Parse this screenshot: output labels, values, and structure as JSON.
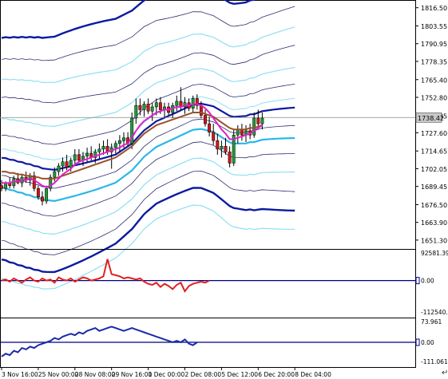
{
  "colors": {
    "background": "#ffffff",
    "frame": "#000000",
    "candle_up": "#1f9a3a",
    "candle_down": "#d01818",
    "ma_fast": "#e020c8",
    "ma_slow": "#9a5028",
    "band_thick": "#0b1aa0",
    "band_thin": "#2c2c70",
    "band_cyan": "#29b7e6",
    "band_cyan_light": "#8fdff3",
    "osc1": "#e02020",
    "osc2": "#1a2aa8",
    "level_line": "#000080",
    "price_marker_bg": "#c8c8c8"
  },
  "chart_data": [
    {
      "type": "candlestick",
      "symbol": "price",
      "ylim": [
        1645,
        1822
      ],
      "y_ticks": [
        "1816.50",
        "1803.55",
        "1790.95",
        "1778.35",
        "1765.40",
        "1752.80",
        "1739.85",
        "1727.60",
        "1714.65",
        "1702.05",
        "1689.45",
        "1676.50",
        "1663.90",
        "1651.30"
      ],
      "current_price_label": "1738.42",
      "current_price": 1738.42,
      "x_labels": [
        "3 Nov 16:00",
        "25 Nov 00:00",
        "28 Nov 08:00",
        "29 Nov 16:00",
        "1 Dec 00:00",
        "2 Dec 08:00",
        "5 Dec 12:00",
        "6 Dec 20:00",
        "8 Dec 04:00"
      ],
      "x_label_index": [
        0,
        9,
        18,
        27,
        36,
        45,
        54,
        63,
        72
      ],
      "candles": [
        {
          "o": 1690,
          "h": 1694,
          "l": 1686,
          "c": 1688
        },
        {
          "o": 1688,
          "h": 1693,
          "l": 1686,
          "c": 1692
        },
        {
          "o": 1692,
          "h": 1696,
          "l": 1688,
          "c": 1690
        },
        {
          "o": 1690,
          "h": 1697,
          "l": 1688,
          "c": 1695
        },
        {
          "o": 1695,
          "h": 1699,
          "l": 1691,
          "c": 1692
        },
        {
          "o": 1692,
          "h": 1698,
          "l": 1689,
          "c": 1696
        },
        {
          "o": 1696,
          "h": 1700,
          "l": 1692,
          "c": 1694
        },
        {
          "o": 1694,
          "h": 1699,
          "l": 1690,
          "c": 1697
        },
        {
          "o": 1697,
          "h": 1700,
          "l": 1686,
          "c": 1688
        },
        {
          "o": 1688,
          "h": 1690,
          "l": 1680,
          "c": 1682
        },
        {
          "o": 1682,
          "h": 1686,
          "l": 1676,
          "c": 1679
        },
        {
          "o": 1679,
          "h": 1690,
          "l": 1677,
          "c": 1688
        },
        {
          "o": 1688,
          "h": 1698,
          "l": 1686,
          "c": 1696
        },
        {
          "o": 1696,
          "h": 1703,
          "l": 1693,
          "c": 1700
        },
        {
          "o": 1700,
          "h": 1706,
          "l": 1697,
          "c": 1704
        },
        {
          "o": 1704,
          "h": 1710,
          "l": 1700,
          "c": 1707
        },
        {
          "o": 1707,
          "h": 1712,
          "l": 1701,
          "c": 1703
        },
        {
          "o": 1703,
          "h": 1710,
          "l": 1700,
          "c": 1708
        },
        {
          "o": 1708,
          "h": 1716,
          "l": 1705,
          "c": 1712
        },
        {
          "o": 1712,
          "h": 1716,
          "l": 1706,
          "c": 1708
        },
        {
          "o": 1708,
          "h": 1714,
          "l": 1704,
          "c": 1711
        },
        {
          "o": 1711,
          "h": 1717,
          "l": 1707,
          "c": 1713
        },
        {
          "o": 1713,
          "h": 1718,
          "l": 1708,
          "c": 1710
        },
        {
          "o": 1710,
          "h": 1716,
          "l": 1706,
          "c": 1714
        },
        {
          "o": 1714,
          "h": 1720,
          "l": 1709,
          "c": 1716
        },
        {
          "o": 1716,
          "h": 1722,
          "l": 1712,
          "c": 1718
        },
        {
          "o": 1718,
          "h": 1723,
          "l": 1712,
          "c": 1714
        },
        {
          "o": 1714,
          "h": 1720,
          "l": 1702,
          "c": 1717
        },
        {
          "o": 1717,
          "h": 1722,
          "l": 1713,
          "c": 1720
        },
        {
          "o": 1720,
          "h": 1726,
          "l": 1714,
          "c": 1722
        },
        {
          "o": 1722,
          "h": 1728,
          "l": 1717,
          "c": 1724
        },
        {
          "o": 1724,
          "h": 1728,
          "l": 1718,
          "c": 1720
        },
        {
          "o": 1720,
          "h": 1742,
          "l": 1716,
          "c": 1738
        },
        {
          "o": 1738,
          "h": 1752,
          "l": 1734,
          "c": 1747
        },
        {
          "o": 1747,
          "h": 1752,
          "l": 1740,
          "c": 1744
        },
        {
          "o": 1744,
          "h": 1750,
          "l": 1739,
          "c": 1748
        },
        {
          "o": 1748,
          "h": 1752,
          "l": 1741,
          "c": 1743
        },
        {
          "o": 1743,
          "h": 1749,
          "l": 1736,
          "c": 1746
        },
        {
          "o": 1746,
          "h": 1752,
          "l": 1740,
          "c": 1749
        },
        {
          "o": 1749,
          "h": 1753,
          "l": 1741,
          "c": 1744
        },
        {
          "o": 1744,
          "h": 1749,
          "l": 1738,
          "c": 1746
        },
        {
          "o": 1746,
          "h": 1749,
          "l": 1740,
          "c": 1742
        },
        {
          "o": 1742,
          "h": 1749,
          "l": 1738,
          "c": 1747
        },
        {
          "o": 1747,
          "h": 1754,
          "l": 1743,
          "c": 1750
        },
        {
          "o": 1750,
          "h": 1760,
          "l": 1744,
          "c": 1746
        },
        {
          "o": 1746,
          "h": 1753,
          "l": 1741,
          "c": 1749
        },
        {
          "o": 1749,
          "h": 1752,
          "l": 1743,
          "c": 1745
        },
        {
          "o": 1745,
          "h": 1754,
          "l": 1742,
          "c": 1752
        },
        {
          "o": 1752,
          "h": 1755,
          "l": 1744,
          "c": 1747
        },
        {
          "o": 1747,
          "h": 1750,
          "l": 1738,
          "c": 1740
        },
        {
          "o": 1740,
          "h": 1744,
          "l": 1732,
          "c": 1734
        },
        {
          "o": 1734,
          "h": 1739,
          "l": 1725,
          "c": 1728
        },
        {
          "o": 1728,
          "h": 1734,
          "l": 1719,
          "c": 1722
        },
        {
          "o": 1722,
          "h": 1727,
          "l": 1712,
          "c": 1716
        },
        {
          "o": 1716,
          "h": 1722,
          "l": 1710,
          "c": 1718
        },
        {
          "o": 1718,
          "h": 1724,
          "l": 1712,
          "c": 1714
        },
        {
          "o": 1714,
          "h": 1718,
          "l": 1703,
          "c": 1706
        },
        {
          "o": 1706,
          "h": 1730,
          "l": 1704,
          "c": 1726
        },
        {
          "o": 1726,
          "h": 1733,
          "l": 1720,
          "c": 1730
        },
        {
          "o": 1730,
          "h": 1734,
          "l": 1722,
          "c": 1726
        },
        {
          "o": 1726,
          "h": 1733,
          "l": 1721,
          "c": 1729
        },
        {
          "o": 1729,
          "h": 1734,
          "l": 1723,
          "c": 1726
        },
        {
          "o": 1726,
          "h": 1742,
          "l": 1724,
          "c": 1738
        },
        {
          "o": 1738,
          "h": 1744,
          "l": 1731,
          "c": 1734
        },
        {
          "o": 1734,
          "h": 1742,
          "l": 1730,
          "c": 1738
        }
      ],
      "ma_fast": [
        1692,
        1692,
        1692,
        1693,
        1693,
        1694,
        1694,
        1695,
        1694,
        1692,
        1690,
        1689,
        1690,
        1692,
        1695,
        1698,
        1700,
        1702,
        1705,
        1707,
        1708,
        1709,
        1710,
        1711,
        1712,
        1713,
        1714,
        1715,
        1716,
        1717,
        1719,
        1720,
        1724,
        1729,
        1733,
        1736,
        1738,
        1740,
        1742,
        1743,
        1744,
        1744,
        1745,
        1746,
        1746,
        1747,
        1747,
        1748,
        1748,
        1747,
        1745,
        1742,
        1738,
        1734,
        1730,
        1727,
        1723,
        1723,
        1724,
        1725,
        1726,
        1727,
        1729,
        1731,
        1733
      ],
      "ma_slow": [
        1700,
        1700,
        1699,
        1699,
        1698,
        1698,
        1697,
        1697,
        1696,
        1696,
        1695,
        1695,
        1695,
        1695,
        1696,
        1697,
        1698,
        1699,
        1700,
        1701,
        1702,
        1703,
        1704,
        1705,
        1706,
        1707,
        1708,
        1709,
        1710,
        1712,
        1714,
        1716,
        1718,
        1721,
        1724,
        1727,
        1729,
        1731,
        1733,
        1734,
        1735,
        1736,
        1737,
        1738,
        1739,
        1740,
        1741,
        1742,
        1742,
        1742,
        1741,
        1740,
        1739,
        1737,
        1735,
        1733,
        1731,
        1730,
        1730,
        1730,
        1730,
        1731,
        1731,
        1732,
        1733
      ]
    },
    {
      "type": "line",
      "series": [
        {
          "values": [
            0,
            1,
            -1,
            2,
            0,
            -2,
            1,
            3,
            0,
            -1,
            2,
            0,
            1,
            -2,
            3,
            1,
            0,
            2,
            -1,
            1,
            3,
            2,
            0,
            1,
            2,
            4,
            20,
            6,
            5,
            4,
            2,
            3,
            2,
            1,
            2,
            -1,
            -3,
            -4,
            -2,
            -6,
            -3,
            -5,
            -8,
            -4,
            -2,
            -10,
            -5,
            -3,
            -2,
            -1,
            -2,
            0
          ]
        }
      ],
      "y_ticks": [
        "92581.39",
        "0.00",
        "-112540.71"
      ],
      "ylim": [
        -30,
        25
      ],
      "zero_level": 0
    },
    {
      "type": "line",
      "series": [
        {
          "values": [
            -10,
            -8,
            -9,
            -6,
            -7,
            -4,
            -5,
            -3,
            -4,
            -2,
            -1,
            0,
            1,
            3,
            2,
            4,
            5,
            6,
            5,
            7,
            6,
            8,
            9,
            10,
            8,
            9,
            10,
            11,
            10,
            9,
            8,
            9,
            10,
            9,
            8,
            7,
            6,
            5,
            4,
            3,
            2,
            1,
            0,
            1,
            0,
            2,
            -1,
            -2,
            0
          ]
        }
      ],
      "y_ticks": [
        "73.961",
        "0.00",
        "-111.061"
      ],
      "ylim": [
        -14,
        14
      ],
      "zero_level": 0
    }
  ]
}
